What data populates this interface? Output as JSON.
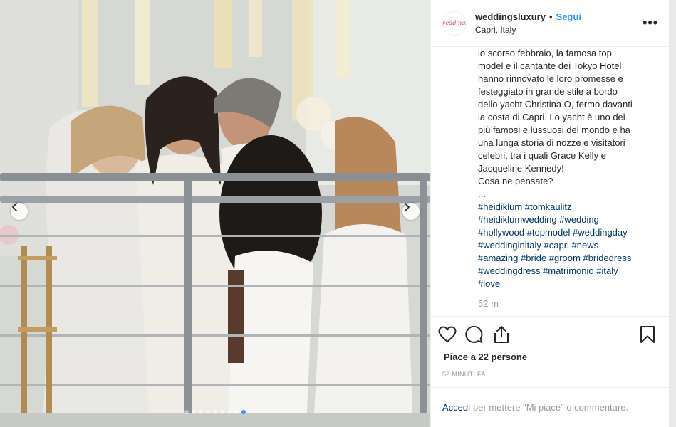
{
  "post": {
    "avatar_text": "weddings",
    "username": "weddingsluxury",
    "separator": "•",
    "follow_label": "Segui",
    "location": "Capri, Italy",
    "more_label": "•••"
  },
  "caption": {
    "lines": [
      "lo scorso febbraio, la famosa top",
      "model e il cantante dei Tokyo Hotel",
      "hanno rinnovato le loro promesse e",
      "festeggiato in grande stile a bordo",
      "dello yacht Christina O, fermo davanti",
      "la costa di Capri. Lo yacht è uno dei",
      "più famosi e lussuosi del mondo e ha",
      "una lunga storia di nozze e visitatori",
      "celebri, tra i quali Grace Kelly e",
      "Jacqueline Kennedy!",
      "Cosa ne pensate?",
      "..."
    ],
    "hashtag_lines": [
      [
        "#heidiklum",
        "#tomkaulitz"
      ],
      [
        "#heidiklumwedding",
        "#wedding"
      ],
      [
        "#hollywood",
        "#topmodel",
        "#weddingday"
      ],
      [
        "#weddinginitaly",
        "#capri",
        "#news"
      ],
      [
        "#amazing",
        "#bride",
        "#groom",
        "#bridedress"
      ],
      [
        "#weddingdress",
        "#matrimonio",
        "#italy"
      ],
      [
        "#love"
      ]
    ],
    "time": "52 m"
  },
  "actions": {
    "like_icon": "heart-icon",
    "comment_icon": "comment-icon",
    "share_icon": "share-icon",
    "save_icon": "bookmark-icon",
    "likes_text": "Piace a 22 persone",
    "post_time": "52 MINUTI FA"
  },
  "comment": {
    "login_label": "Accedi",
    "prompt": "per mettere \"Mi piace\" o commentare."
  },
  "carousel": {
    "prev_icon": "chevron-left-icon",
    "next_icon": "chevron-right-icon",
    "slide_count": 9,
    "active_slide": 9
  },
  "colors": {
    "accent": "#3897f0",
    "link": "#003569",
    "text": "#262626",
    "muted": "#999999"
  }
}
